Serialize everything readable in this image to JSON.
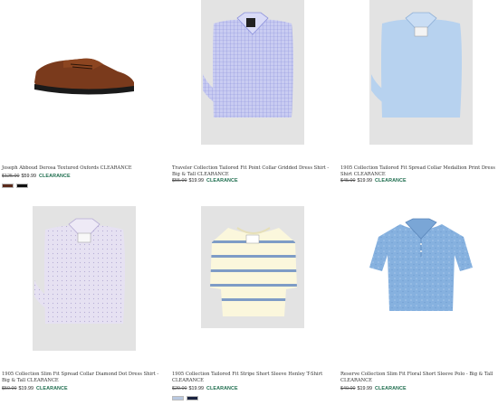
{
  "products": [
    {
      "title": "Joseph Abboud Derosa Textured Oxfords CLEARANCE",
      "old_price": "$125.00",
      "new_price": "$59.99",
      "badge": "CLEARANCE",
      "swatches": [
        "#5a2a1a",
        "#111111"
      ],
      "image": "brown-oxford-shoe-icon"
    },
    {
      "title": "Traveler Collection Tailored Fit Point Collar Gridded Dress Shirt - Big & Tall CLEARANCE",
      "old_price": "$55.00",
      "new_price": "$19.99",
      "badge": "CLEARANCE",
      "swatches": [],
      "image": "gridded-dress-shirt-icon"
    },
    {
      "title": "1905 Collection Tailored Fit Spread Collar Medallion Print Dress Shirt CLEARANCE",
      "old_price": "$45.00",
      "new_price": "$19.99",
      "badge": "CLEARANCE",
      "swatches": [],
      "image": "blue-dress-shirt-icon"
    },
    {
      "title": "1905 Collection Slim Fit Spread Collar Diamond Dot Dress Shirt - Big & Tall CLEARANCE",
      "old_price": "$50.00",
      "new_price": "$19.99",
      "badge": "CLEARANCE",
      "swatches": [],
      "image": "lavender-dress-shirt-icon"
    },
    {
      "title": "1905 Collection Tailored Fit Stripe Short Sleeve Henley T-Shirt CLEARANCE",
      "old_price": "$29.00",
      "new_price": "$19.99",
      "badge": "CLEARANCE",
      "swatches": [
        "#b8c8e0",
        "#1a2340"
      ],
      "image": "striped-henley-tshirt-icon"
    },
    {
      "title": "Reserve Collection Slim Fit Floral Short Sleeve Polo - Big & Tall CLEARANCE",
      "old_price": "$40.00",
      "new_price": "$19.99",
      "badge": "CLEARANCE",
      "swatches": [],
      "image": "blue-polo-shirt-icon"
    }
  ]
}
